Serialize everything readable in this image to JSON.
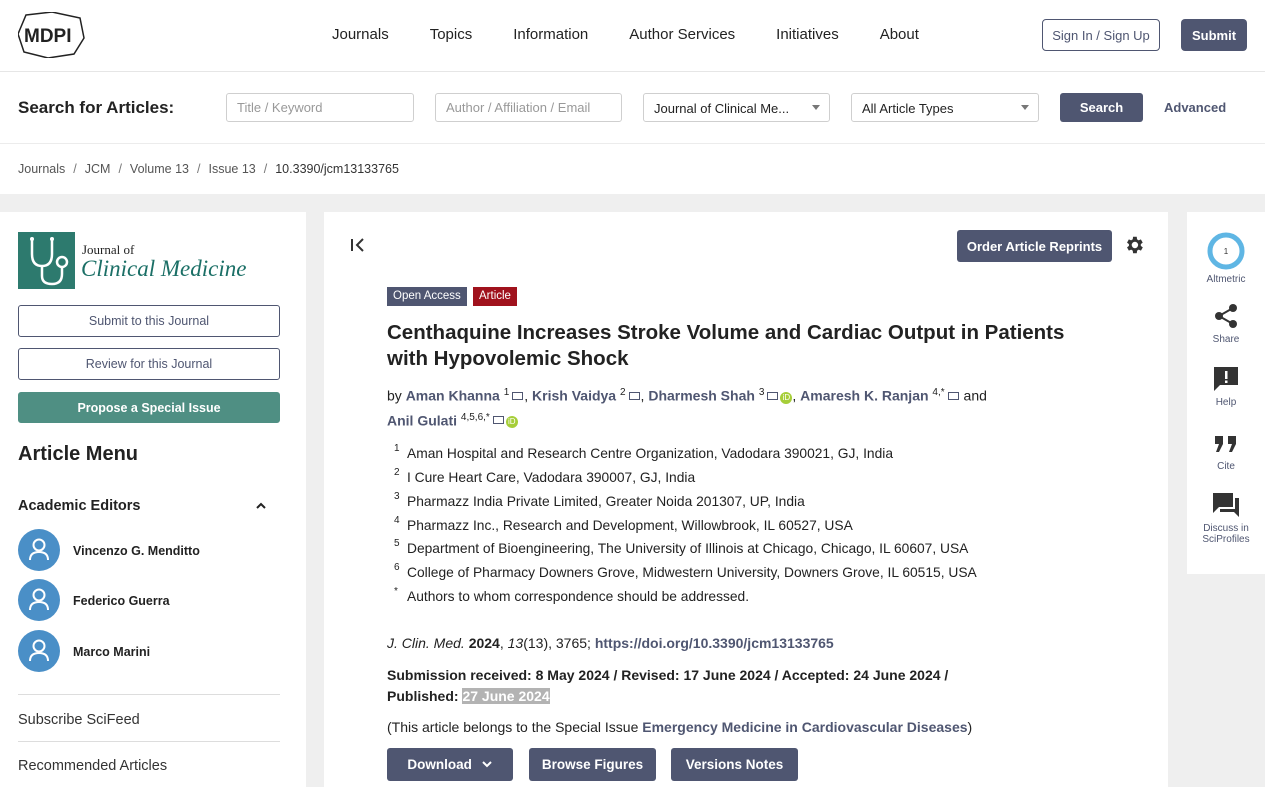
{
  "nav": {
    "logo_text": "MDPI",
    "links": [
      "Journals",
      "Topics",
      "Information",
      "Author Services",
      "Initiatives",
      "About"
    ],
    "signin_label": "Sign In / Sign Up",
    "submit_label": "Submit"
  },
  "search": {
    "label": "Search for Articles:",
    "title_placeholder": "Title / Keyword",
    "author_placeholder": "Author / Affiliation / Email",
    "journal_selected": "Journal of Clinical Me...",
    "type_selected": "All Article Types",
    "search_label": "Search",
    "advanced_label": "Advanced"
  },
  "breadcrumb": [
    "Journals",
    "JCM",
    "Volume 13",
    "Issue 13",
    "10.3390/jcm13133765"
  ],
  "sidebar": {
    "journal_line1": "Journal of",
    "journal_line2": "Clinical Medicine",
    "submit_journal": "Submit to this Journal",
    "review_journal": "Review for this Journal",
    "propose_issue": "Propose a Special Issue",
    "article_menu": "Article Menu",
    "academic_editors": "Academic Editors",
    "editors": [
      "Vincenzo G. Menditto",
      "Federico Guerra",
      "Marco Marini"
    ],
    "subscribe": "Subscribe SciFeed",
    "recommended": "Recommended Articles"
  },
  "article": {
    "reprints_label": "Order Article Reprints",
    "badge_open_access": "Open Access",
    "badge_article": "Article",
    "title": "Centhaquine Increases Stroke Volume and Cardiac Output in Patients with Hypovolemic Shock",
    "by": "by",
    "authors": [
      {
        "name": "Aman Khanna",
        "sup": "1"
      },
      {
        "name": "Krish Vaidya",
        "sup": "2"
      },
      {
        "name": "Dharmesh Shah",
        "sup": "3"
      },
      {
        "name": "Amaresh K. Ranjan",
        "sup": "4,*"
      },
      {
        "name": "Anil Gulati",
        "sup": "4,5,6,*"
      }
    ],
    "and": "and",
    "affiliations": [
      {
        "sup": "1",
        "text": "Aman Hospital and Research Centre Organization, Vadodara 390021, GJ, India"
      },
      {
        "sup": "2",
        "text": "I Cure Heart Care, Vadodara 390007, GJ, India"
      },
      {
        "sup": "3",
        "text": "Pharmazz India Private Limited, Greater Noida 201307, UP, India"
      },
      {
        "sup": "4",
        "text": "Pharmazz Inc., Research and Development, Willowbrook, IL 60527, USA"
      },
      {
        "sup": "5",
        "text": "Department of Bioengineering, The University of Illinois at Chicago, Chicago, IL 60607, USA"
      },
      {
        "sup": "6",
        "text": "College of Pharmacy Downers Grove, Midwestern University, Downers Grove, IL 60515, USA"
      },
      {
        "sup": "*",
        "text": "Authors to whom correspondence should be addressed."
      }
    ],
    "cite_journal": "J. Clin. Med.",
    "cite_year": "2024",
    "cite_volume": "13",
    "cite_rest": "(13), 3765;",
    "doi": "https://doi.org/10.3390/jcm13133765",
    "dates_line1": "Submission received: 8 May 2024 / Revised: 17 June 2024 / Accepted: 24 June 2024 /",
    "published_label": "Published:",
    "published_date": "27 June 2024",
    "special_prefix": "(This article belongs to the Special Issue",
    "special_issue": "Emergency Medicine in Cardiovascular Diseases",
    "special_suffix": ")",
    "download_label": "Download",
    "figures_label": "Browse Figures",
    "versions_label": "Versions Notes"
  },
  "rail": {
    "altmetric_score": "1",
    "altmetric": "Altmetric",
    "share": "Share",
    "help": "Help",
    "cite": "Cite",
    "discuss_line1": "Discuss in",
    "discuss_line2": "SciProfiles"
  },
  "colors": {
    "primary": "#4f5671",
    "journal_green": "#2d7a6e",
    "propose_green": "#4f8f83",
    "article_badge": "#a0121d"
  }
}
